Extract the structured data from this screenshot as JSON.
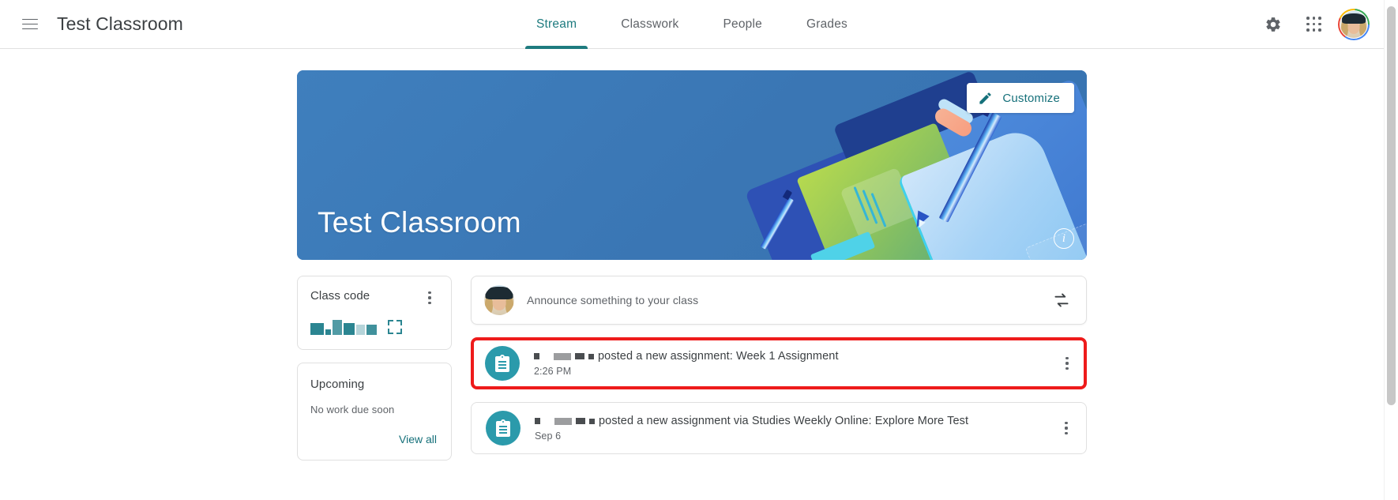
{
  "app": {
    "title": "Test Classroom",
    "menu_icon": "hamburger-menu-icon"
  },
  "tabs": [
    {
      "label": "Stream",
      "active": true
    },
    {
      "label": "Classwork",
      "active": false
    },
    {
      "label": "People",
      "active": false
    },
    {
      "label": "Grades",
      "active": false
    }
  ],
  "topbar_right": {
    "settings_icon": "gear-icon",
    "apps_icon": "apps-grid-icon",
    "avatar": "user-avatar"
  },
  "banner": {
    "class_name": "Test Classroom",
    "customize_label": "Customize",
    "customize_icon": "pencil-icon",
    "info_icon": "info-icon",
    "theme_color": "#3b7ab8"
  },
  "class_code_card": {
    "title": "Class code",
    "code_value": "",
    "code_redacted": true,
    "overflow_icon": "kebab-menu-icon",
    "expand_icon": "fullscreen-expand-icon",
    "accent_color": "#2b8591"
  },
  "upcoming_card": {
    "title": "Upcoming",
    "empty_text": "No work due soon",
    "view_all_label": "View all",
    "link_color": "#15707a"
  },
  "announce_box": {
    "placeholder": "Announce something to your class",
    "avatar": "user-avatar",
    "reuse_icon": "swap-arrows-icon"
  },
  "stream_posts": [
    {
      "icon": "assignment-clipboard-icon",
      "icon_color": "#2b9aab",
      "author_redacted": true,
      "text": "posted a new assignment: Week 1 Assignment",
      "timestamp": "2:26 PM",
      "overflow_icon": "kebab-menu-icon",
      "highlighted": true,
      "highlight_color": "#ee1b1b"
    },
    {
      "icon": "assignment-clipboard-icon",
      "icon_color": "#2b9aab",
      "author_redacted": true,
      "text": "posted a new assignment via Studies Weekly Online: Explore More Test",
      "timestamp": "Sep 6",
      "overflow_icon": "kebab-menu-icon",
      "highlighted": false
    }
  ],
  "scrollbar": {
    "visible": true
  }
}
